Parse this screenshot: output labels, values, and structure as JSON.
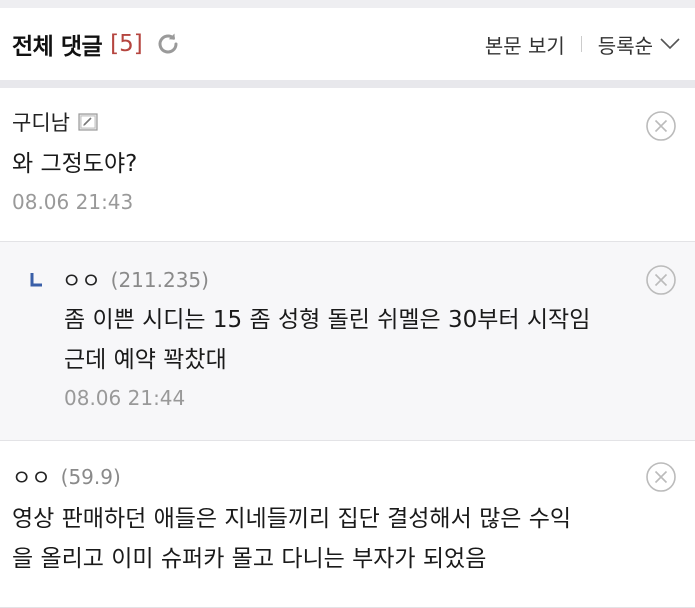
{
  "header": {
    "title": "전체 댓글",
    "count": "[5]",
    "view_body_label": "본문 보기",
    "sort_label": "등록순"
  },
  "comments": [
    {
      "author": "구디남",
      "ip": "",
      "text_lines": [
        "와 그정도야?"
      ],
      "date": "08.06 21:43",
      "is_reply": false
    },
    {
      "author": "ㅇㅇ",
      "ip": "(211.235)",
      "text_lines": [
        "좀 이쁜 시디는 15 좀 성형 돌린 쉬멜은 30부터 시작임",
        "근데 예약 꽉찼대"
      ],
      "date": "08.06 21:44",
      "is_reply": true
    },
    {
      "author": "ㅇㅇ",
      "ip": "(59.9)",
      "text_lines": [
        "영상 판매하던 애들은 지네들끼리 집단 결성해서 많은 수익",
        "을 올리고 이미 슈퍼카 몰고 다니는 부자가 되었음"
      ],
      "date": "",
      "is_reply": false
    }
  ],
  "icons": {
    "refresh": "refresh-icon",
    "sort_chevron": "chevron-down-icon",
    "delete": "close-circle-icon",
    "memo": "memo-icon",
    "reply": "reply-arrow-icon"
  },
  "colors": {
    "count": "#b5453f",
    "reply_mark": "#3a5fa8",
    "reply_bg": "#f7f7f9"
  }
}
